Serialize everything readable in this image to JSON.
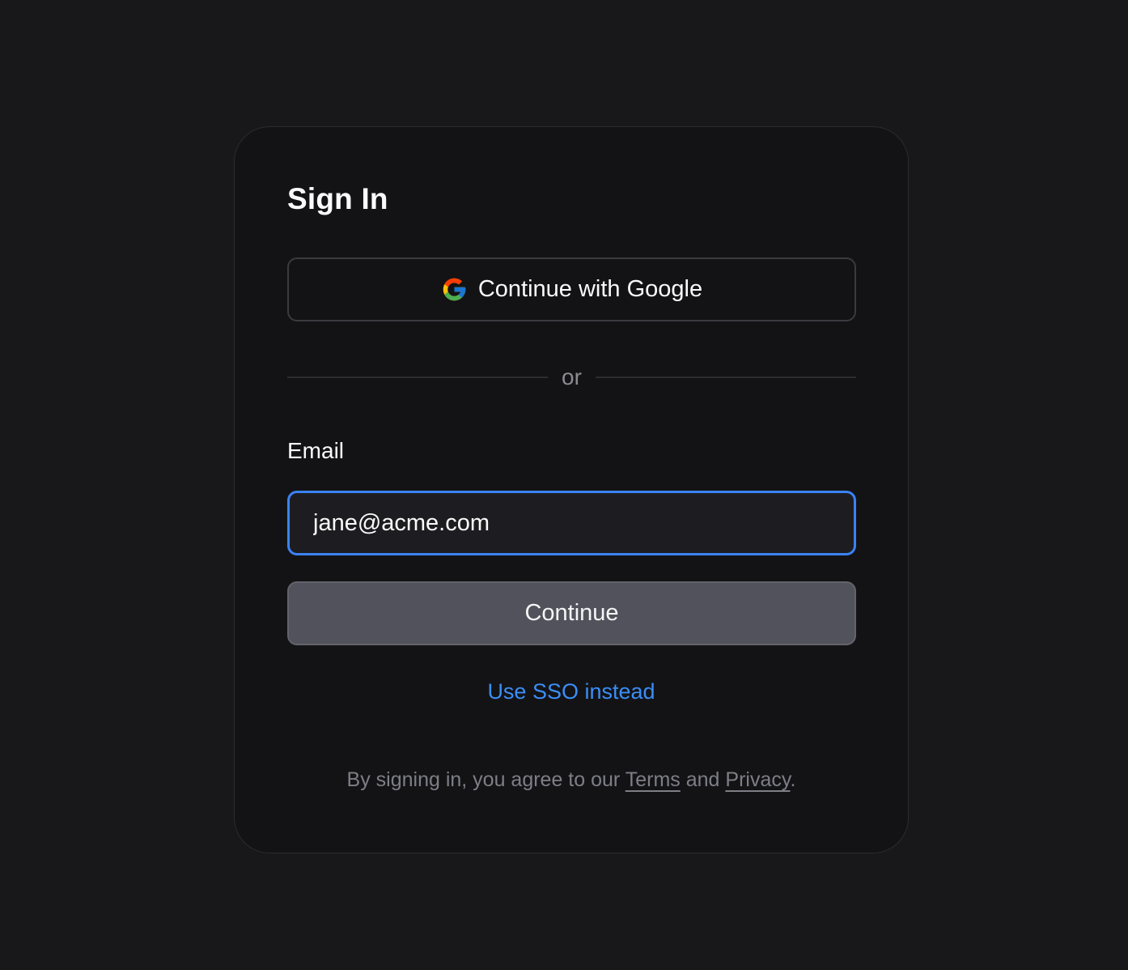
{
  "signin": {
    "title": "Sign In",
    "google_button_label": "Continue with Google",
    "divider_text": "or",
    "email_label": "Email",
    "email_value": "jane@acme.com",
    "continue_label": "Continue",
    "sso_link": "Use SSO instead",
    "legal": {
      "prefix": "By signing in, you agree to our ",
      "terms": "Terms",
      "middle": " and ",
      "privacy": "Privacy",
      "suffix": "."
    }
  },
  "icons": {
    "google": "google-g-logo"
  },
  "colors": {
    "background": "#18181b",
    "card": "#131316",
    "focus_ring": "#3b82f6",
    "link": "#3b8ef6",
    "primary_button": "#52525c",
    "muted_text": "#7e7e86"
  }
}
